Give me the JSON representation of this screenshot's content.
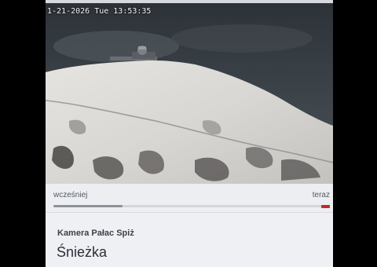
{
  "webcam": {
    "timestamp": "1-21-2026 Tue 13:53:35",
    "colors": {
      "sky": "#3a4046",
      "snow": "#dedcd8",
      "rock": "#5c5a58"
    }
  },
  "timeline": {
    "earlier_label": "wcześniej",
    "now_label": "teraz",
    "progress": 0.25,
    "colors": {
      "track": "#d3d6dc",
      "fill": "#8c9099",
      "marker": "#c62828"
    }
  },
  "camera": {
    "subtitle": "Kamera Pałac Spiż",
    "title": "Śnieżka"
  }
}
